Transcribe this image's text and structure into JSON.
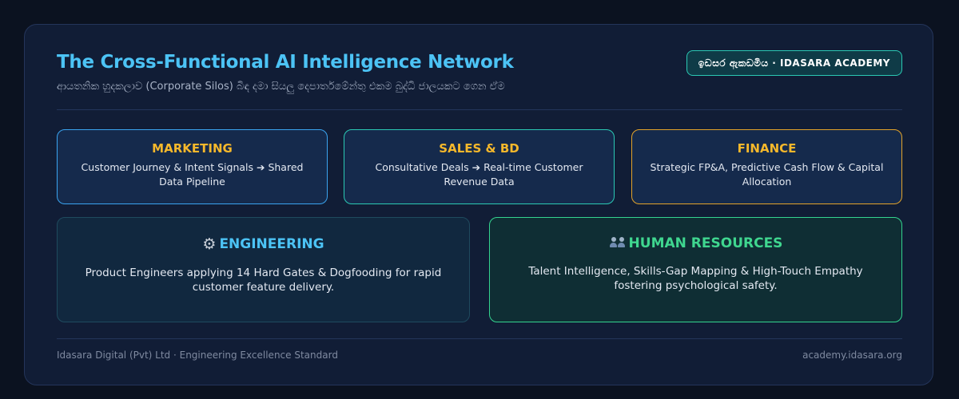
{
  "header": {
    "title": "The Cross-Functional AI Intelligence Network",
    "subtitle": "ආයතනික හුදකලාව (Corporate Silos) බිඳ දමා සියලු දෙපාර්තමේන්තු එකම බුද්ධි ජාලයකට ගෙන ඒම",
    "badge": "ඉඩසර ඇකඩමිය · IDASARA ACADEMY"
  },
  "departments": {
    "marketing": {
      "title": "MARKETING",
      "description": "Customer Journey & Intent Signals ➔ Shared Data Pipeline"
    },
    "sales": {
      "title": "SALES & BD",
      "description": "Consultative Deals ➔ Real-time Customer Revenue Data"
    },
    "finance": {
      "title": "FINANCE",
      "description": "Strategic FP&A, Predictive Cash Flow & Capital Allocation"
    },
    "engineering": {
      "icon": "gear-icon",
      "title": "ENGINEERING",
      "description": "Product Engineers applying 14 Hard Gates & Dogfooding for rapid customer feature delivery."
    },
    "hr": {
      "icon": "people-icon",
      "title": "HUMAN RESOURCES",
      "description": "Talent Intelligence, Skills-Gap Mapping & High-Touch Empathy fostering psychological safety."
    }
  },
  "footer": {
    "left": "Idasara Digital (Pvt) Ltd · Engineering Excellence Standard",
    "right": "academy.idasara.org"
  },
  "colors": {
    "background": "#0b1220",
    "panel": "#111d36",
    "title": "#4cc3f5",
    "department_title": "#f6b82b",
    "hr_title": "#3fd68f",
    "badge_border": "#2bc9b4"
  }
}
